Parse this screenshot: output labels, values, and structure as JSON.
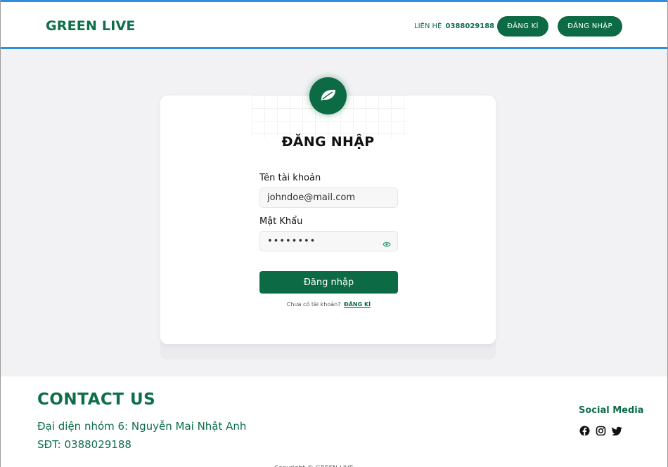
{
  "header": {
    "logo": "GREEN LIVE",
    "contact_label": "LIÊN HỆ",
    "contact_phone": "0388029188",
    "register_button": "ĐĂNG KÍ",
    "login_button": "ĐĂNG NHẬP"
  },
  "login_card": {
    "title": "ĐĂNG NHẬP",
    "username_label": "Tên tài khoản",
    "username_value": "johndoe@mail.com",
    "password_label": "Mật Khẩu",
    "password_value": "••••••••",
    "submit_label": "Đăng nhập",
    "no_account_text": "Chưa có tài khoản?",
    "signup_link": "ĐĂNG KÍ"
  },
  "footer": {
    "title": "CONTACT US",
    "representative": "Đại diện nhóm 6: Nguyễn Mai Nhật Anh",
    "phone": "SĐT: 0388029188",
    "social_title": "Social Media",
    "social_icons": [
      "facebook-icon",
      "instagram-icon",
      "twitter-icon"
    ],
    "bottom_text": "Copyright © GREEN LIVE"
  },
  "colors": {
    "brand_green": "#0c6b45",
    "header_border": "#2f8fdd",
    "page_background": "#f2f2f4"
  }
}
